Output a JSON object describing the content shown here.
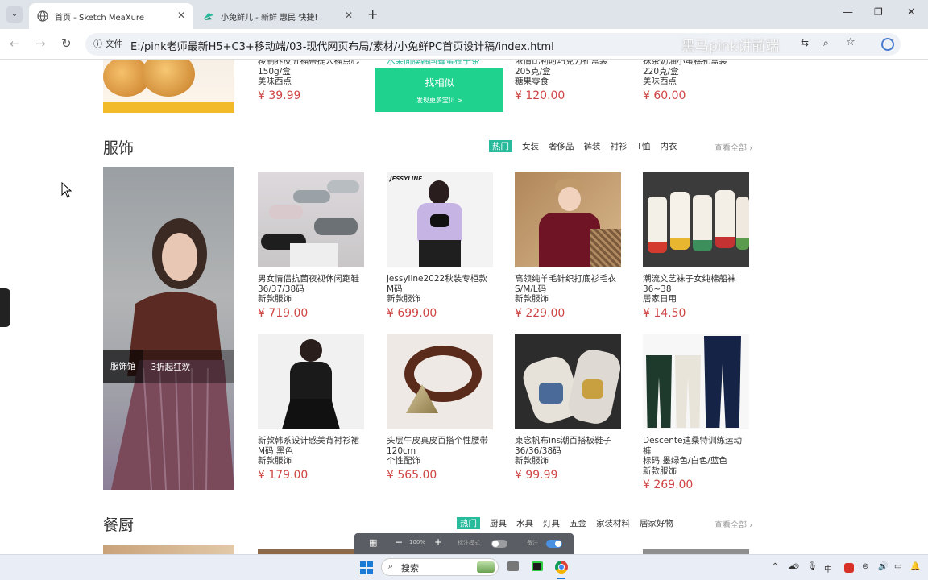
{
  "browser": {
    "tabs": [
      {
        "title": "首页 - Sketch MeaXure",
        "active": true
      },
      {
        "title": "小兔鲜儿 - 新鲜 惠民 快捷!",
        "active": false
      }
    ],
    "url_prefix": "文件",
    "url": "E:/pink老师最新H5+C3+移动端/03-现代网页布局/素材/小兔鲜PC首页设计稿/index.html",
    "watermark": "黑马pink讲前端"
  },
  "top_row": {
    "items": [
      {
        "name": "梭制养皮五福蒂提人福点心",
        "spec": "150g/盒",
        "cat": "美味西点",
        "price": "¥ 39.99"
      },
      {
        "name": "浓情比利时巧克力礼盒装",
        "spec": "205克/盒",
        "cat": "糖果零食",
        "price": "¥ 120.00"
      },
      {
        "name": "抹茶奶油小蛋糕礼盒装",
        "spec": "220克/盒",
        "cat": "美味西点",
        "price": "¥ 60.00"
      }
    ],
    "promo_partial": "水果面膜韩国蜂蜜柚子茶",
    "find_similar": "找相似",
    "discover_more": "发现更多宝贝 >"
  },
  "clothing": {
    "title": "服饰",
    "tabs": [
      "热门",
      "女装",
      "奢侈品",
      "裤装",
      "衬衫",
      "T恤",
      "内衣"
    ],
    "view_all": "查看全部",
    "banner_tag": "服饰馆",
    "banner_promo": "3折起狂欢",
    "products": [
      {
        "name": "男女情侣抗菌夜视休闲跑鞋",
        "spec": "36/37/38码",
        "cat": "新款服饰",
        "price": "¥ 719.00"
      },
      {
        "name": "jessyline2022秋装专柜款",
        "spec": "M码",
        "cat": "新款服饰",
        "price": "¥ 699.00",
        "brand": "JESSYLINE"
      },
      {
        "name": "高领纯羊毛针织打底衫毛衣",
        "spec": "S/M/L码",
        "cat": "新款服饰",
        "price": "¥ 229.00"
      },
      {
        "name": "潮流文艺袜子女纯棉船袜",
        "spec": "36~38",
        "cat": "居家日用",
        "price": "¥ 14.50"
      },
      {
        "name": "新款韩系设计感美背衬衫裙",
        "spec": "M码 黑色",
        "cat": "新款服饰",
        "price": "¥ 179.00"
      },
      {
        "name": "头层牛皮真皮百搭个性腰带",
        "spec": "120cm",
        "cat": "个性配饰",
        "price": "¥ 565.00"
      },
      {
        "name": "柬念帆布ins潮百搭板鞋子",
        "spec": "36/36/38码",
        "cat": "新款服饰",
        "price": "¥ 99.99"
      },
      {
        "name": "Descente迪桑特训练运动裤",
        "spec": "标码 墨绿色/白色/蓝色",
        "cat": "新款服饰",
        "price": "¥ 269.00"
      }
    ]
  },
  "kitchen": {
    "title": "餐厨",
    "tabs": [
      "热门",
      "厨具",
      "水具",
      "灯具",
      "五金",
      "家装材料",
      "居家好物"
    ],
    "view_all": "查看全部"
  },
  "measure_toolbar": {
    "zoom": "100%",
    "label1": "标注模式",
    "label2": "备注"
  },
  "taskbar": {
    "search_placeholder": "搜索",
    "ime": "中",
    "colors": {
      "accent": "#27ba9b",
      "price": "#cf4444"
    }
  }
}
